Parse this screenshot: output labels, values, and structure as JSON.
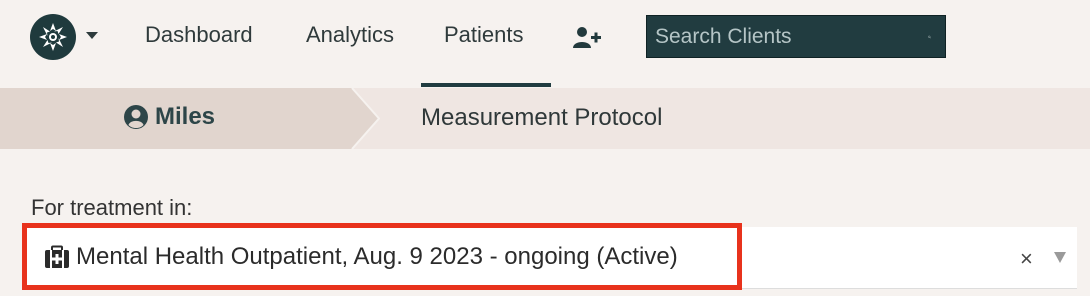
{
  "nav": {
    "items": [
      {
        "label": "Dashboard"
      },
      {
        "label": "Analytics"
      },
      {
        "label": "Patients"
      }
    ],
    "active": "Patients",
    "add_user_icon": "user-plus-icon",
    "search": {
      "placeholder": "Search Clients",
      "icon": "search-icon"
    },
    "logo_icon": "logo-icon"
  },
  "breadcrumb": {
    "patient_name": "Miles",
    "patient_icon": "user-circle-icon",
    "current": "Measurement Protocol"
  },
  "treatment": {
    "label": "For treatment in:",
    "selected": "Mental Health Outpatient, Aug. 9 2023 - ongoing (Active)",
    "selected_icon": "medical-kit-icon",
    "clear_symbol": "×"
  },
  "colors": {
    "accent": "#213c40",
    "highlight": "#e8321c",
    "breadcrumb_bg": "#efe6e2",
    "breadcrumb_home_bg": "#e1d5ce"
  }
}
